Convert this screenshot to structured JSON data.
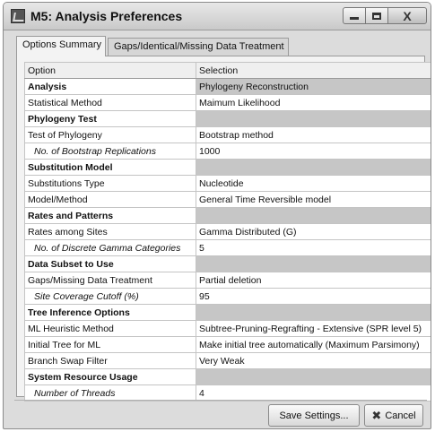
{
  "window": {
    "title": "M5: Analysis Preferences"
  },
  "tabs": [
    {
      "label": "Options Summary",
      "active": true
    },
    {
      "label": "Gaps/Identical/Missing Data Treatment",
      "active": false
    }
  ],
  "table": {
    "headers": [
      "Option",
      "Selection"
    ],
    "rows": [
      {
        "option": "Analysis",
        "selection": "Phylogeny Reconstruction",
        "group": true
      },
      {
        "option": "Statistical Method",
        "selection": "Maimum Likelihood"
      },
      {
        "option": "Phylogeny Test",
        "selection": "",
        "group": true
      },
      {
        "option": "Test of Phylogeny",
        "selection": "Bootstrap method"
      },
      {
        "option": "No. of Bootstrap Replications",
        "selection": "1000",
        "indent": true
      },
      {
        "option": "Substitution Model",
        "selection": "",
        "group": true
      },
      {
        "option": "Substitutions Type",
        "selection": "Nucleotide"
      },
      {
        "option": "Model/Method",
        "selection": "General Time Reversible model"
      },
      {
        "option": "Rates and Patterns",
        "selection": "",
        "group": true
      },
      {
        "option": "Rates among Sites",
        "selection": "Gamma Distributed (G)"
      },
      {
        "option": "No. of Discrete Gamma Categories",
        "selection": "5",
        "indent": true
      },
      {
        "option": "Data Subset to Use",
        "selection": "",
        "group": true
      },
      {
        "option": "Gaps/Missing Data Treatment",
        "selection": "Partial deletion"
      },
      {
        "option": "Site Coverage Cutoff (%)",
        "selection": "95",
        "indent": true
      },
      {
        "option": "Tree Inference Options",
        "selection": "",
        "group": true
      },
      {
        "option": "ML Heuristic Method",
        "selection": "Subtree-Pruning-Regrafting - Extensive (SPR level 5)"
      },
      {
        "option": "Initial Tree for ML",
        "selection": "Make initial tree automatically (Maximum Parsimony)"
      },
      {
        "option": "Branch Swap Filter",
        "selection": "Very Weak"
      },
      {
        "option": "System Resource Usage",
        "selection": "",
        "group": true
      },
      {
        "option": "Number of Threads",
        "selection": "4",
        "indent": true
      }
    ]
  },
  "buttons": {
    "save": "Save Settings...",
    "cancel": "Cancel"
  }
}
